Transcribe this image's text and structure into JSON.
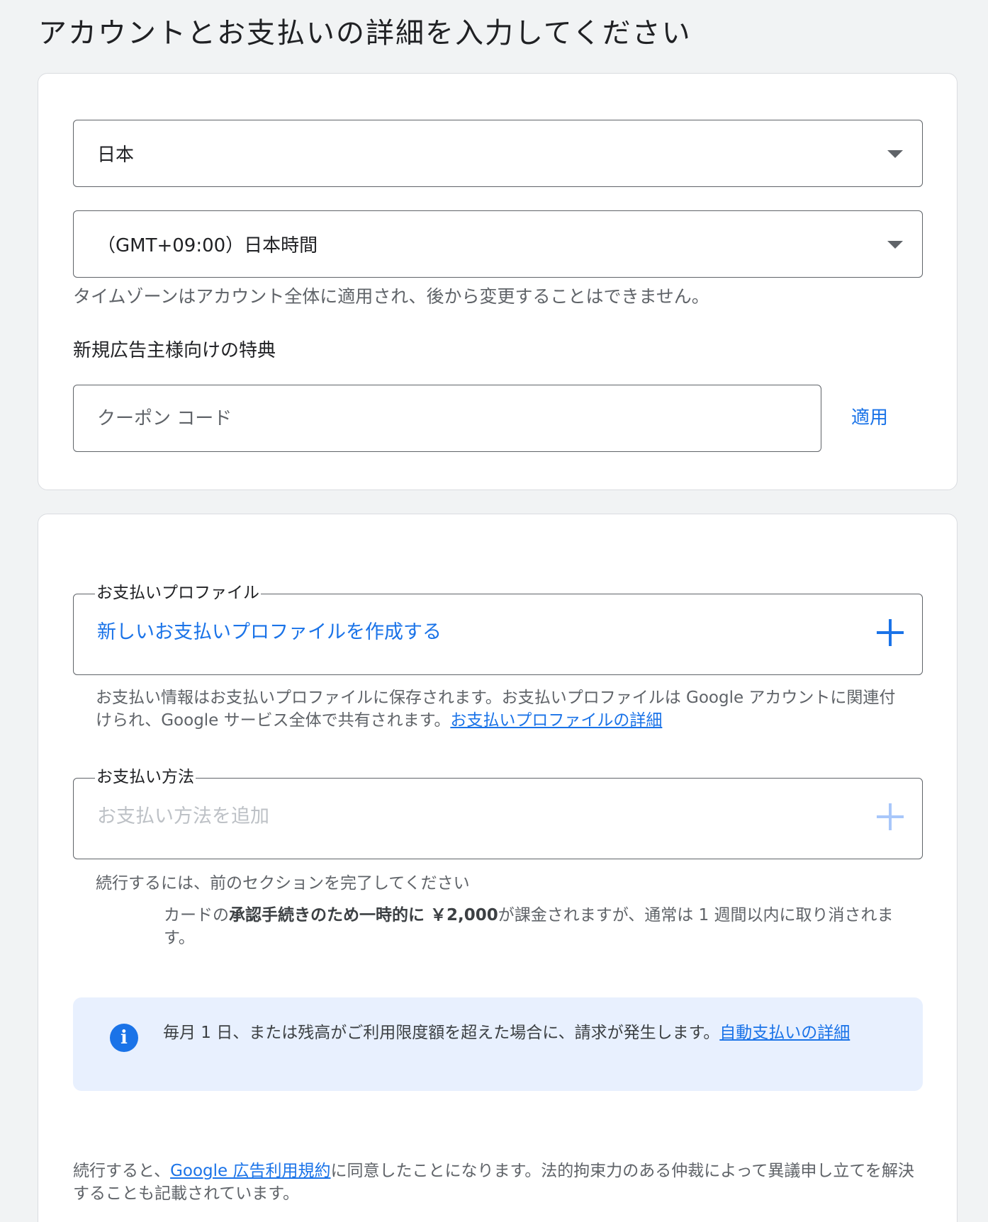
{
  "page": {
    "title": "アカウントとお支払いの詳細を入力してください"
  },
  "account": {
    "country": "日本",
    "timezone": "（GMT+09:00）日本時間",
    "timezone_helper": "タイムゾーンはアカウント全体に適用され、後から変更することはできません。",
    "offer_label": "新規広告主様向けの特典",
    "coupon_placeholder": "クーポン コード",
    "apply_label": "適用"
  },
  "payment": {
    "profile_legend": "お支払いプロファイル",
    "profile_value": "新しいお支払いプロファイルを作成する",
    "profile_note": "お支払い情報はお支払いプロファイルに保存されます。お支払いプロファイルは Google アカウントに関連付けられ、Google サービス全体で共有されます。",
    "profile_note_link": "お支払いプロファイルの詳細",
    "method_legend": "お支払い方法",
    "method_value": "お支払い方法を追加",
    "method_note": "続行するには、前のセクションを完了してください",
    "charge_prefix": "カードの",
    "charge_bold": "承認手続きのため一時的に ￥2,000",
    "charge_suffix": "が課金されますが、通常は 1 週間以内に取り消されます。"
  },
  "info": {
    "text": "毎月 1 日、または残高がご利用限度額を超えた場合に、請求が発生します。",
    "link": "自動支払いの詳細"
  },
  "terms": {
    "prefix": "続行すると、",
    "link": "Google 広告利用規約",
    "suffix": "に同意したことになります。法的拘束力のある仲裁によって異議申し立てを解決することも記載されています。"
  },
  "colors": {
    "accent": "#1a73e8",
    "info_bg": "#e8f0fe",
    "page_bg": "#f1f3f4"
  }
}
